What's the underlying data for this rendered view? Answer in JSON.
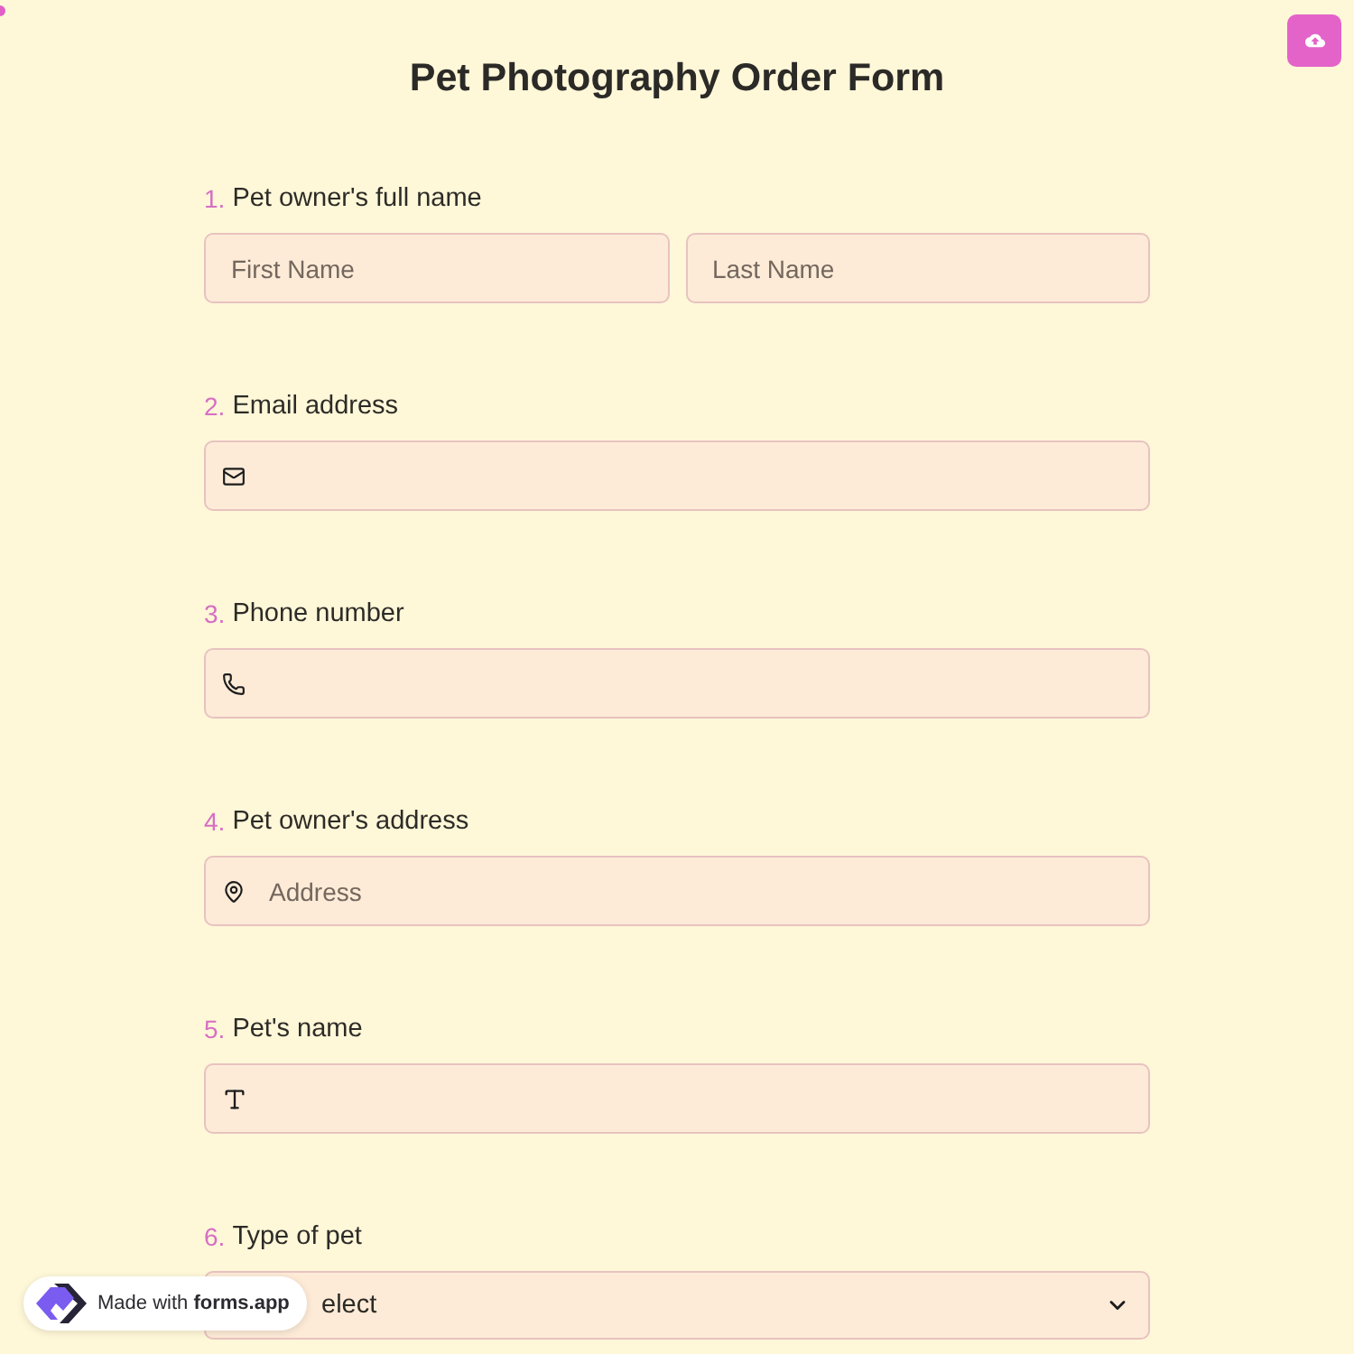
{
  "title": "Pet Photography Order Form",
  "questions": [
    {
      "number": "1.",
      "label": "Pet owner's full name",
      "kind": "name",
      "fields": [
        {
          "placeholder": "First Name"
        },
        {
          "placeholder": "Last Name"
        }
      ]
    },
    {
      "number": "2.",
      "label": "Email address",
      "kind": "email"
    },
    {
      "number": "3.",
      "label": "Phone number",
      "kind": "phone"
    },
    {
      "number": "4.",
      "label": "Pet owner's address",
      "kind": "address",
      "placeholder": "Address"
    },
    {
      "number": "5.",
      "label": "Pet's name",
      "kind": "text"
    },
    {
      "number": "6.",
      "label": "Type of pet",
      "kind": "select",
      "placeholder": "elect"
    }
  ],
  "badge": {
    "text": "Made with **forms.app**"
  }
}
